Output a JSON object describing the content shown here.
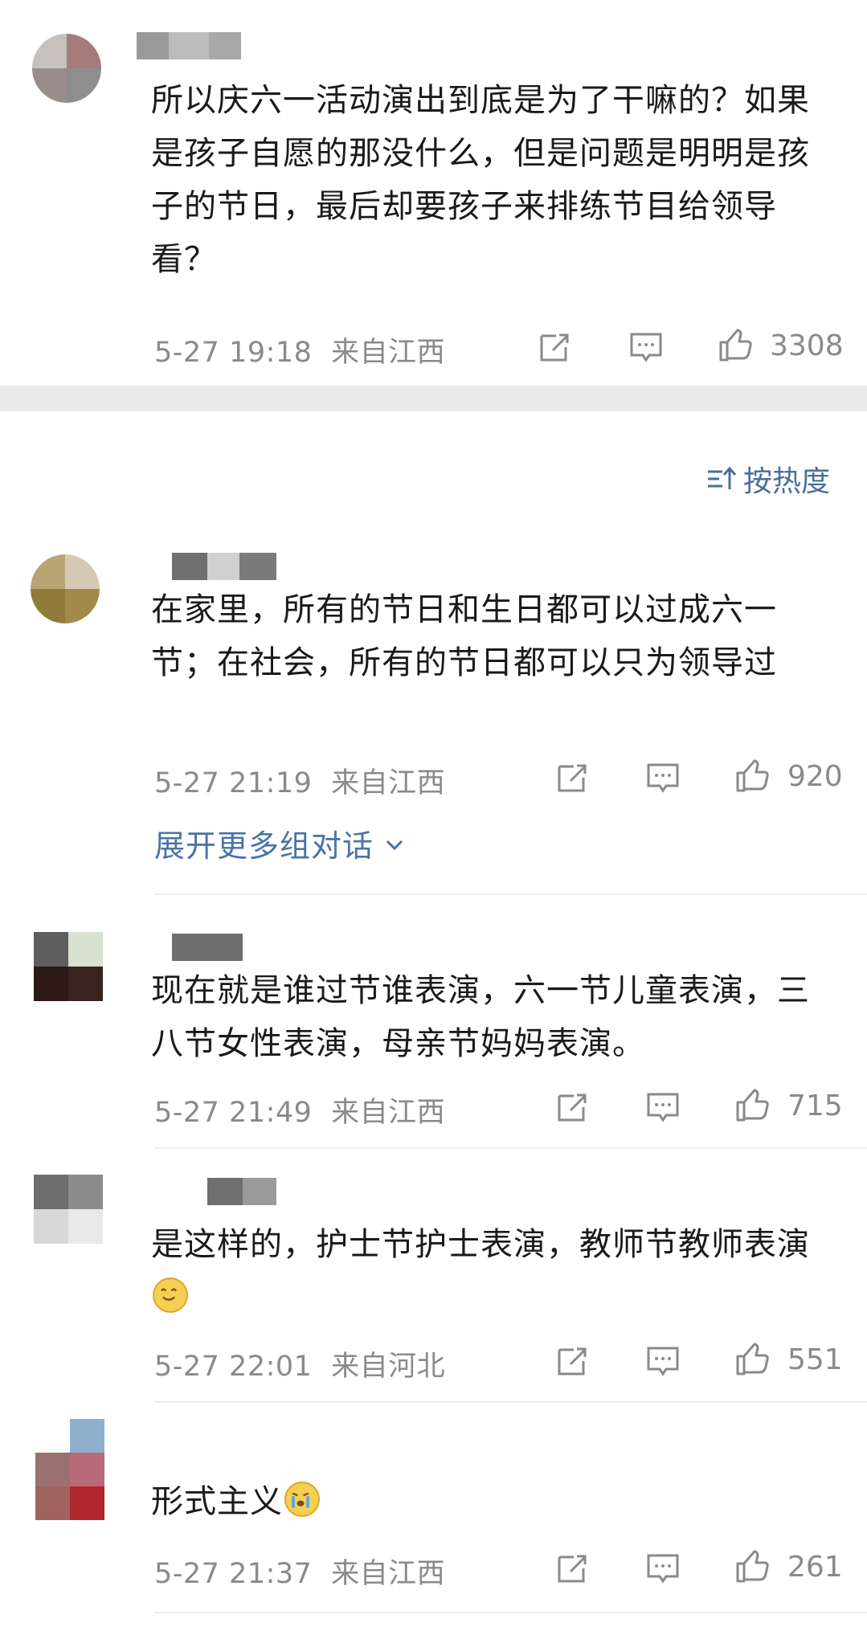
{
  "comments": [
    {
      "text": "所以庆六一活动演出到底是为了干嘛的？如果是孩子自愿的那没什么，但是问题是明明是孩子的节日，最后却要孩子来排练节目给领导看？",
      "time": "5-27 19:18",
      "location": "来自江西",
      "likes": "3308"
    },
    {
      "text": "在家里，所有的节日和生日都可以过成六一节；在社会，所有的节日都可以只为领导过",
      "time": "5-27 21:19",
      "location": "来自江西",
      "likes": "920"
    },
    {
      "text": "现在就是谁过节谁表演，六一节儿童表演，三八节女性表演，母亲节妈妈表演。",
      "time": "5-27 21:49",
      "location": "来自江西",
      "likes": "715"
    },
    {
      "text": "是这样的，护士节护士表演，教师节教师表演",
      "time": "5-27 22:01",
      "location": "来自河北",
      "likes": "551"
    },
    {
      "text": "形式主义",
      "time": "5-27 21:37",
      "location": "来自江西",
      "likes": "261"
    }
  ],
  "sort_label": "按热度",
  "expand_label": "展开更多组对话",
  "icons": {
    "repost": "repost-icon",
    "comment": "comment-icon",
    "like": "thumbs-up-icon",
    "sort": "sort-icon",
    "chevron": "chevron-down-icon",
    "emoji_face": "smile-face-emoji",
    "emoji_cry": "crying-face-emoji"
  },
  "colors": {
    "link": "#4a72a6",
    "meta": "#8a8a8a",
    "text": "#1a1a1a"
  }
}
